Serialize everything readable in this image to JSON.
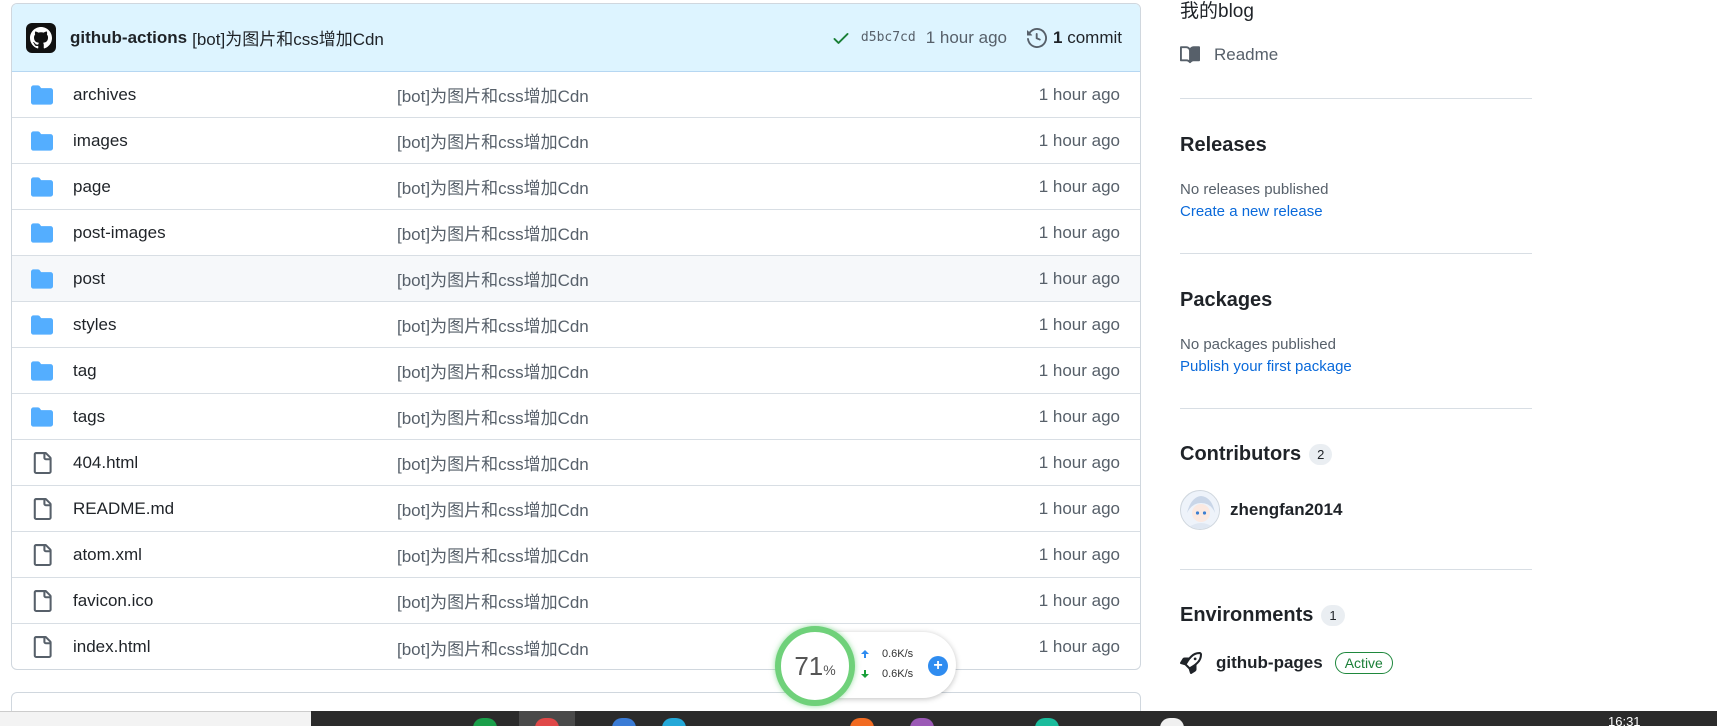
{
  "latest_commit": {
    "author": "github-actions",
    "message": "[bot]为图片和css增加Cdn",
    "sha": "d5bc7cd",
    "time": "1 hour ago",
    "commit_count": "1",
    "commit_label": "commit"
  },
  "files": [
    {
      "name": "archives",
      "type": "folder",
      "message": "[bot]为图片和css增加Cdn",
      "time": "1 hour ago"
    },
    {
      "name": "images",
      "type": "folder",
      "message": "[bot]为图片和css增加Cdn",
      "time": "1 hour ago"
    },
    {
      "name": "page",
      "type": "folder",
      "message": "[bot]为图片和css增加Cdn",
      "time": "1 hour ago"
    },
    {
      "name": "post-images",
      "type": "folder",
      "message": "[bot]为图片和css增加Cdn",
      "time": "1 hour ago"
    },
    {
      "name": "post",
      "type": "folder",
      "message": "[bot]为图片和css增加Cdn",
      "time": "1 hour ago"
    },
    {
      "name": "styles",
      "type": "folder",
      "message": "[bot]为图片和css增加Cdn",
      "time": "1 hour ago"
    },
    {
      "name": "tag",
      "type": "folder",
      "message": "[bot]为图片和css增加Cdn",
      "time": "1 hour ago"
    },
    {
      "name": "tags",
      "type": "folder",
      "message": "[bot]为图片和css增加Cdn",
      "time": "1 hour ago"
    },
    {
      "name": "404.html",
      "type": "file",
      "message": "[bot]为图片和css增加Cdn",
      "time": "1 hour ago"
    },
    {
      "name": "README.md",
      "type": "file",
      "message": "[bot]为图片和css增加Cdn",
      "time": "1 hour ago"
    },
    {
      "name": "atom.xml",
      "type": "file",
      "message": "[bot]为图片和css增加Cdn",
      "time": "1 hour ago"
    },
    {
      "name": "favicon.ico",
      "type": "file",
      "message": "[bot]为图片和css增加Cdn",
      "time": "1 hour ago"
    },
    {
      "name": "index.html",
      "type": "file",
      "message": "[bot]为图片和css增加Cdn",
      "time": "1 hour ago"
    }
  ],
  "sidebar": {
    "about_text": "我的blog",
    "readme_label": "Readme",
    "releases": {
      "title": "Releases",
      "empty_text": "No releases published",
      "link": "Create a new release"
    },
    "packages": {
      "title": "Packages",
      "empty_text": "No packages published",
      "link": "Publish your first package"
    },
    "contributors": {
      "title": "Contributors",
      "count": "2",
      "users": [
        {
          "name": "zhengfan2014"
        }
      ]
    },
    "environments": {
      "title": "Environments",
      "count": "1",
      "items": [
        {
          "name": "github-pages",
          "status": "Active"
        }
      ]
    }
  },
  "widget": {
    "percent": "71",
    "percent_sign": "%",
    "upload": "0.6K/s",
    "download": "0.6K/s"
  },
  "taskbar": {
    "clock": "16:31"
  },
  "colors": {
    "accent": "#0969da",
    "folder": "#54aeff",
    "success": "#1a7f37",
    "commit_bar": "#ddf4ff"
  }
}
